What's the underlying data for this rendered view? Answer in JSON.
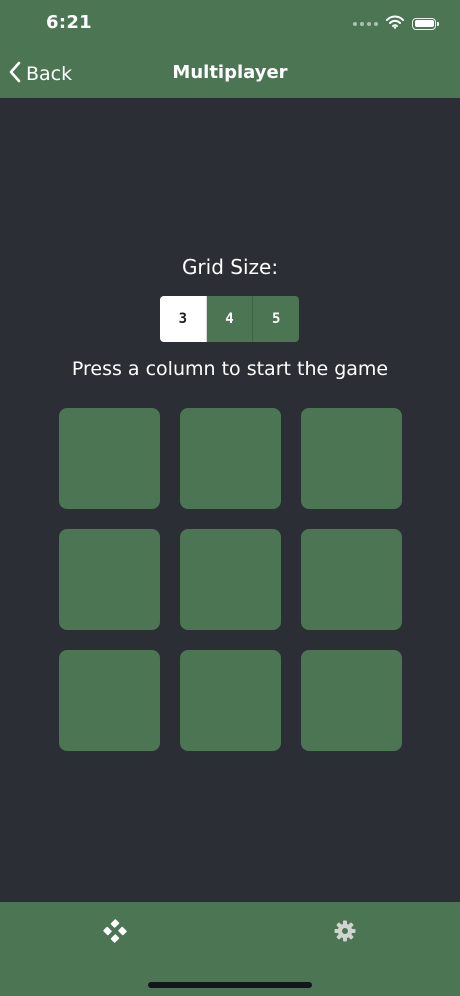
{
  "status_bar": {
    "time": "6:21",
    "icons": [
      "signal-dots-icon",
      "wifi-icon",
      "battery-icon"
    ]
  },
  "nav": {
    "back_label": "Back",
    "back_icon": "chevron-left-icon",
    "title": "Multiplayer"
  },
  "grid_size": {
    "label": "Grid Size:",
    "options": [
      "3",
      "4",
      "5"
    ],
    "selected": "3"
  },
  "instruction": "Press a column to start the game",
  "board": {
    "rows": 3,
    "columns": 3
  },
  "tabbar": {
    "items": [
      {
        "icon": "gamepad-icon",
        "name": "games"
      },
      {
        "icon": "gear-icon",
        "name": "settings"
      }
    ]
  },
  "colors": {
    "accent_green": "#4b7553",
    "background": "#2b2e34",
    "text": "#ffffff",
    "selected_segment": "#ffffff"
  }
}
